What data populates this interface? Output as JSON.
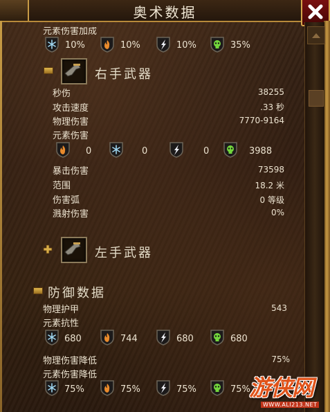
{
  "window": {
    "title": "奥术数据",
    "close_label": "close"
  },
  "top_partial": {
    "label": "元素伤害加成",
    "items": [
      {
        "icon": "frost-icon",
        "value": "10%"
      },
      {
        "icon": "fire-icon",
        "value": "10%"
      },
      {
        "icon": "lightning-icon",
        "value": "10%"
      },
      {
        "icon": "poison-icon",
        "value": "35%"
      }
    ]
  },
  "right_weapon": {
    "heading": "右手武器",
    "dps_label": "秒伤",
    "dps_value": "38255",
    "speed_label": "攻击速度",
    "speed_value": ".33 秒",
    "physical_label": "物理伤害",
    "physical_value": "7770-9164",
    "elemental_label": "元素伤害",
    "elemental": [
      {
        "icon": "fire-icon",
        "value": "0"
      },
      {
        "icon": "frost-icon",
        "value": "0"
      },
      {
        "icon": "lightning-icon",
        "value": "0"
      },
      {
        "icon": "poison-icon",
        "value": "3988"
      }
    ],
    "crit_label": "暴击伤害",
    "crit_value": "73598",
    "range_label": "范围",
    "range_value": "18.2 米",
    "arc_label": "伤害弧",
    "arc_value": "0 等级",
    "splash_label": "溅射伤害",
    "splash_value": "0%"
  },
  "left_weapon": {
    "heading": "左手武器"
  },
  "defense": {
    "heading": "防御数据",
    "armor_label": "物理护甲",
    "armor_value": "543",
    "resist_label": "元素抗性",
    "resists": [
      {
        "icon": "frost-icon",
        "value": "680"
      },
      {
        "icon": "fire-icon",
        "value": "744"
      },
      {
        "icon": "lightning-icon",
        "value": "680"
      },
      {
        "icon": "poison-icon",
        "value": "680"
      }
    ],
    "phys_reduce_label": "物理伤害降低",
    "phys_reduce_value": "75%",
    "elem_reduce_label": "元素伤害降低",
    "elem_reduce": [
      {
        "icon": "frost-icon",
        "value": "75%"
      },
      {
        "icon": "fire-icon",
        "value": "75%"
      },
      {
        "icon": "lightning-icon",
        "value": "75%"
      },
      {
        "icon": "poison-icon",
        "value": "75%"
      }
    ]
  },
  "watermark": {
    "text": "游侠网",
    "url": "WWW.ALI213.NET"
  },
  "colors": {
    "frost": "#8ec9e6",
    "fire": "#e08a2a",
    "lightning": "#e8e8f0",
    "poison": "#6ed23a",
    "accent": "#c89b46"
  }
}
